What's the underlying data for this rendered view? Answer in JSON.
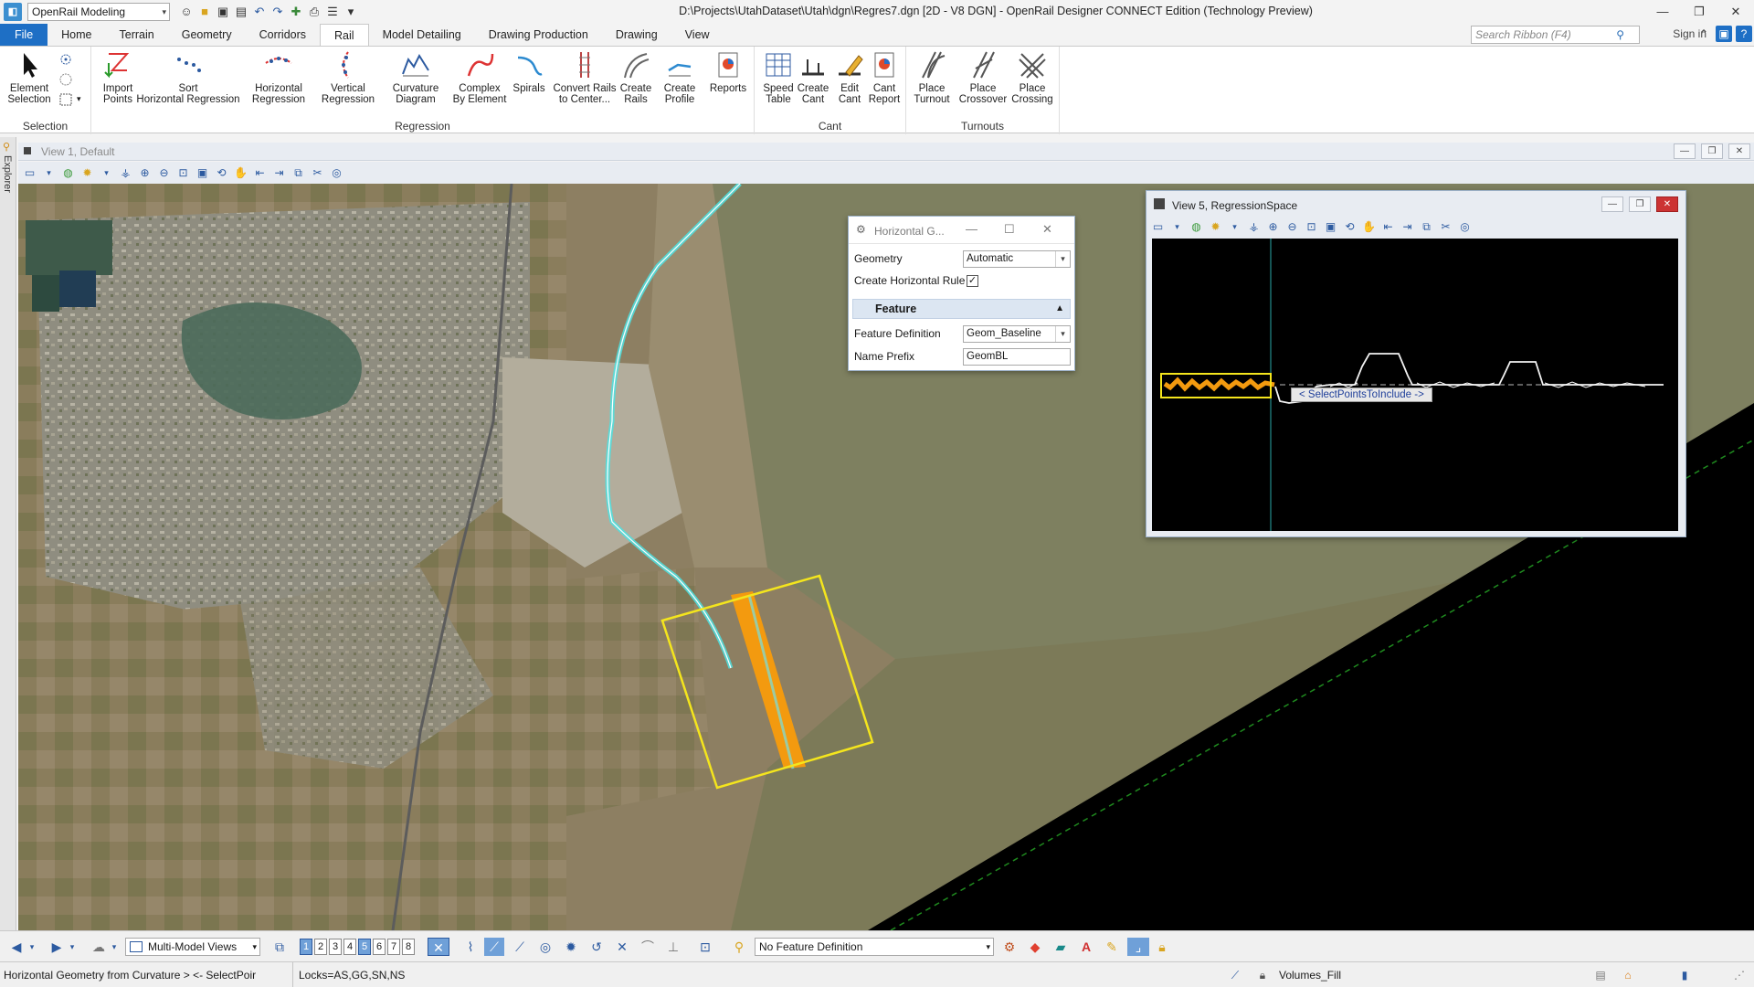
{
  "titlebar": {
    "workflow": "OpenRail Modeling",
    "title": "D:\\Projects\\UtahDataset\\Utah\\dgn\\Regres7.dgn [2D - V8 DGN] - OpenRail Designer CONNECT Edition (Technology Preview)"
  },
  "ribbon": {
    "tabs": [
      "File",
      "Home",
      "Terrain",
      "Geometry",
      "Corridors",
      "Rail",
      "Model Detailing",
      "Drawing Production",
      "Drawing",
      "View"
    ],
    "active_tab": "Rail",
    "search_placeholder": "Search Ribbon (F4)",
    "sign_in": "Sign in",
    "groups": {
      "selection": {
        "label": "Selection",
        "element_selection": "Element\nSelection"
      },
      "regression": {
        "label": "Regression",
        "import_points": "Import\nPoints",
        "sort": "Sort\nHorizontal Regression",
        "horizontal_regression": "Horizontal\nRegression",
        "vertical_regression": "Vertical\nRegression",
        "curvature_diagram": "Curvature\nDiagram",
        "complex_by_element": "Complex\nBy Element",
        "spirals": "Spirals",
        "convert_rails": "Convert Rails\nto Center...",
        "create_rails": "Create\nRails",
        "create_profile": "Create\nProfile",
        "reports": "Reports"
      },
      "cant": {
        "label": "Cant",
        "speed_table": "Speed\nTable",
        "create_cant": "Create\nCant",
        "edit_cant": "Edit\nCant",
        "cant_report": "Cant\nReport"
      },
      "turnouts": {
        "label": "Turnouts",
        "place_turnout": "Place\nTurnout",
        "place_crossover": "Place\nCrossover",
        "place_crossing": "Place\nCrossing"
      }
    }
  },
  "explorer": {
    "label": "Explorer"
  },
  "view1": {
    "title": "View 1, Default"
  },
  "dialog": {
    "title": "Horizontal G...",
    "geometry_label": "Geometry",
    "geometry_value": "Automatic",
    "create_rule_label": "Create Horizontal Rule",
    "create_rule_checked": true,
    "section": "Feature",
    "feature_def_label": "Feature Definition",
    "feature_def_value": "Geom_Baseline",
    "name_prefix_label": "Name Prefix",
    "name_prefix_value": "GeomBL"
  },
  "view5": {
    "title": "View 5, RegressionSpace",
    "tooltip": "< SelectPointsToInclude ->"
  },
  "bottom_toolbar": {
    "multi_model_views": "Multi-Model Views",
    "view_numbers": [
      "1",
      "2",
      "3",
      "4",
      "5",
      "6",
      "7",
      "8"
    ],
    "active_views": [
      "1",
      "5"
    ],
    "feature_definition": "No Feature Definition"
  },
  "statusbar": {
    "prompt": "Horizontal Geometry from Curvature > <- SelectPoir",
    "locks": "Locks=AS,GG,SN,NS",
    "level": "Volumes_Fill"
  },
  "colors": {
    "accent": "#1e6fc5",
    "alignment": "#4fe0e0",
    "selection_band": "#f39a0f",
    "selection_box": "#f4e51d"
  }
}
